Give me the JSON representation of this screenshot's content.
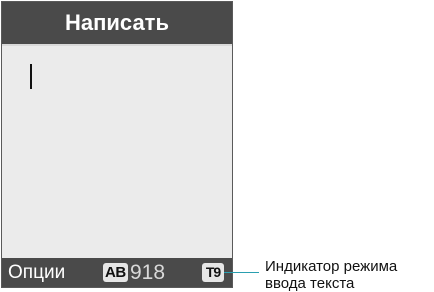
{
  "header": {
    "title": "Написать"
  },
  "editor": {
    "text": ""
  },
  "softbar": {
    "left_label": "Опции",
    "input_mode": "AB",
    "char_counter": "918",
    "t9_indicator": "T9"
  },
  "callout": {
    "line1": "Индикатор режима",
    "line2": "ввода текста"
  },
  "colors": {
    "bar_background": "#4a4a4a",
    "screen_background": "#ebebeb",
    "callout_line": "#2a9fb0"
  }
}
